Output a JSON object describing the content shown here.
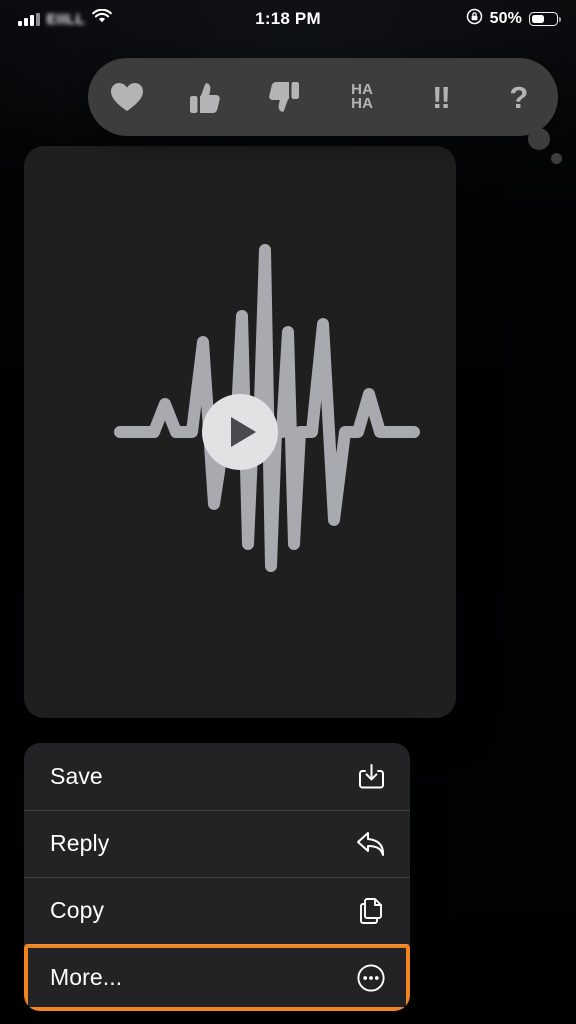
{
  "status_bar": {
    "carrier": "EIILL",
    "time": "1:18 PM",
    "battery_percent": "50%",
    "battery_level": 50,
    "signal_bars": 4,
    "icons": {
      "cellular": "signal-bars-icon",
      "wifi": "wifi-icon",
      "rotation_lock": "rotation-lock-icon",
      "battery": "battery-icon"
    }
  },
  "tapback_bar": {
    "reactions": [
      {
        "name": "heart",
        "icon": "heart-icon",
        "label": ""
      },
      {
        "name": "thumbs-up",
        "icon": "thumbs-up-icon",
        "label": ""
      },
      {
        "name": "thumbs-down",
        "icon": "thumbs-down-icon",
        "label": ""
      },
      {
        "name": "haha",
        "icon": "haha-icon",
        "label_line1": "HA",
        "label_line2": "HA"
      },
      {
        "name": "exclamation",
        "icon": "double-exclamation-icon",
        "label": "!!"
      },
      {
        "name": "question",
        "icon": "question-mark-icon",
        "label": "?"
      }
    ],
    "background_color": "#3d3d3d",
    "glyph_color": "#b4b4b6"
  },
  "message": {
    "type": "video-attachment",
    "thumbnail": {
      "name": "audio-waveform-thumbnail",
      "background_color": "#1f1f20",
      "waveform_color": "#a9aab0"
    },
    "play_button": {
      "name": "play-button",
      "circle_color": "#e2e2e4",
      "triangle_color": "#4a4a4e"
    }
  },
  "context_menu": {
    "background_color": "#232325",
    "highlight_color": "#ef8421",
    "items": [
      {
        "label": "Save",
        "icon": "save-download-icon",
        "highlighted": false
      },
      {
        "label": "Reply",
        "icon": "reply-arrow-icon",
        "highlighted": false
      },
      {
        "label": "Copy",
        "icon": "copy-pages-icon",
        "highlighted": false
      },
      {
        "label": "More...",
        "icon": "more-ellipsis-circle-icon",
        "highlighted": true
      }
    ]
  },
  "background": {
    "description": "blurred messages conversation",
    "bubble_color": "#1273d8"
  }
}
